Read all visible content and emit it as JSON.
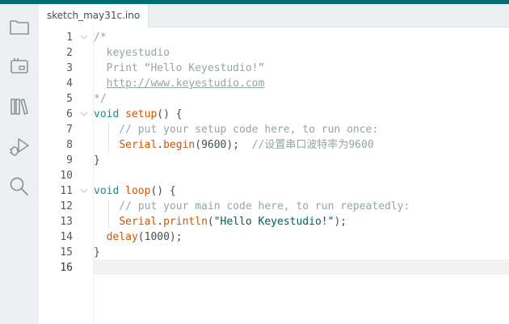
{
  "tab": {
    "label": "sketch_may31c.ino"
  },
  "sidebar": {
    "items": [
      {
        "name": "sketchbook",
        "icon": "folder-icon"
      },
      {
        "name": "boards-manager",
        "icon": "board-icon"
      },
      {
        "name": "library-manager",
        "icon": "library-icon"
      },
      {
        "name": "debug",
        "icon": "debug-icon"
      },
      {
        "name": "search",
        "icon": "search-icon"
      }
    ]
  },
  "editor": {
    "current_line": 16,
    "lines": [
      {
        "num": "1",
        "tokens": [
          {
            "t": "/*",
            "c": "comment"
          }
        ]
      },
      {
        "num": "2",
        "tokens": [
          {
            "t": "  keyestudio",
            "c": "comment"
          }
        ]
      },
      {
        "num": "3",
        "tokens": [
          {
            "t": "  Print “Hello Keyestudio!”",
            "c": "comment"
          }
        ]
      },
      {
        "num": "4",
        "tokens": [
          {
            "t": "  ",
            "c": "comment"
          },
          {
            "t": "http://www.keyestudio.com",
            "c": "comment link"
          }
        ]
      },
      {
        "num": "5",
        "tokens": [
          {
            "t": "*/",
            "c": "comment"
          }
        ]
      },
      {
        "num": "6",
        "tokens": [
          {
            "t": "void",
            "c": "kw"
          },
          {
            "t": " ",
            "c": "plain"
          },
          {
            "t": "setup",
            "c": "fn"
          },
          {
            "t": "() {",
            "c": "plain"
          }
        ]
      },
      {
        "num": "7",
        "tokens": [
          {
            "t": "    // put your setup code here, to run once:",
            "c": "comment"
          }
        ]
      },
      {
        "num": "8",
        "tokens": [
          {
            "t": "    ",
            "c": "plain"
          },
          {
            "t": "Serial",
            "c": "fn"
          },
          {
            "t": ".",
            "c": "plain"
          },
          {
            "t": "begin",
            "c": "fn"
          },
          {
            "t": "(9600);  ",
            "c": "plain"
          },
          {
            "t": "//设置串口波特率为9600",
            "c": "comment"
          }
        ]
      },
      {
        "num": "9",
        "tokens": [
          {
            "t": "}",
            "c": "plain"
          }
        ]
      },
      {
        "num": "10",
        "tokens": []
      },
      {
        "num": "11",
        "tokens": [
          {
            "t": "void",
            "c": "kw"
          },
          {
            "t": " ",
            "c": "plain"
          },
          {
            "t": "loop",
            "c": "fn"
          },
          {
            "t": "() {",
            "c": "plain"
          }
        ]
      },
      {
        "num": "12",
        "tokens": [
          {
            "t": "    // put your main code here, to run repeatedly:",
            "c": "comment"
          }
        ]
      },
      {
        "num": "13",
        "tokens": [
          {
            "t": "    ",
            "c": "plain"
          },
          {
            "t": "Serial",
            "c": "fn"
          },
          {
            "t": ".",
            "c": "plain"
          },
          {
            "t": "println",
            "c": "fn"
          },
          {
            "t": "(",
            "c": "plain"
          },
          {
            "t": "\"Hello Keyestudio!\"",
            "c": "str"
          },
          {
            "t": ");",
            "c": "plain"
          }
        ]
      },
      {
        "num": "14",
        "tokens": [
          {
            "t": "  ",
            "c": "plain"
          },
          {
            "t": "delay",
            "c": "fn"
          },
          {
            "t": "(1000);",
            "c": "plain"
          }
        ]
      },
      {
        "num": "15",
        "tokens": [
          {
            "t": "}",
            "c": "plain"
          }
        ]
      },
      {
        "num": "16",
        "tokens": []
      }
    ]
  },
  "colors": {
    "accent": "#006d72",
    "keyword": "#00979c",
    "function": "#d35400",
    "comment": "#95a5a6",
    "string": "#005c5f",
    "text": "#434f54"
  }
}
